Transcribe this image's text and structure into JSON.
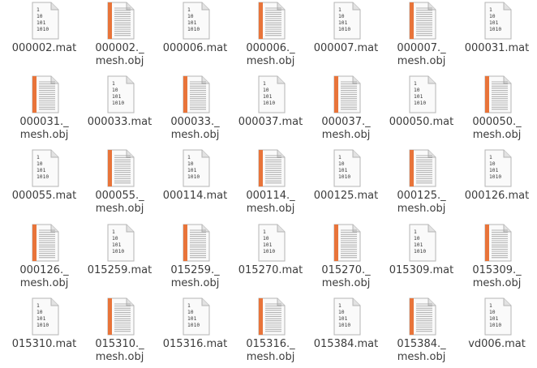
{
  "window": {
    "view": "icon-grid"
  },
  "binary_icon_lines": [
    "1",
    "10",
    "101",
    "1010"
  ],
  "files": [
    {
      "label": "000002.mat",
      "icon": "binary-file-icon"
    },
    {
      "label": "000002._\nmesh.obj",
      "icon": "text-document-icon"
    },
    {
      "label": "000006.mat",
      "icon": "binary-file-icon"
    },
    {
      "label": "000006._\nmesh.obj",
      "icon": "text-document-icon"
    },
    {
      "label": "000007.mat",
      "icon": "binary-file-icon"
    },
    {
      "label": "000007._\nmesh.obj",
      "icon": "text-document-icon"
    },
    {
      "label": "000031.mat",
      "icon": "binary-file-icon"
    },
    {
      "label": "000031._\nmesh.obj",
      "icon": "text-document-icon"
    },
    {
      "label": "000033.mat",
      "icon": "binary-file-icon"
    },
    {
      "label": "000033._\nmesh.obj",
      "icon": "text-document-icon"
    },
    {
      "label": "000037.mat",
      "icon": "binary-file-icon"
    },
    {
      "label": "000037._\nmesh.obj",
      "icon": "text-document-icon"
    },
    {
      "label": "000050.mat",
      "icon": "binary-file-icon"
    },
    {
      "label": "000050._\nmesh.obj",
      "icon": "text-document-icon"
    },
    {
      "label": "000055.mat",
      "icon": "binary-file-icon"
    },
    {
      "label": "000055._\nmesh.obj",
      "icon": "text-document-icon"
    },
    {
      "label": "000114.mat",
      "icon": "binary-file-icon"
    },
    {
      "label": "000114._\nmesh.obj",
      "icon": "text-document-icon"
    },
    {
      "label": "000125.mat",
      "icon": "binary-file-icon"
    },
    {
      "label": "000125._\nmesh.obj",
      "icon": "text-document-icon"
    },
    {
      "label": "000126.mat",
      "icon": "binary-file-icon"
    },
    {
      "label": "000126._\nmesh.obj",
      "icon": "text-document-icon"
    },
    {
      "label": "015259.mat",
      "icon": "binary-file-icon"
    },
    {
      "label": "015259._\nmesh.obj",
      "icon": "text-document-icon"
    },
    {
      "label": "015270.mat",
      "icon": "binary-file-icon"
    },
    {
      "label": "015270._\nmesh.obj",
      "icon": "text-document-icon"
    },
    {
      "label": "015309.mat",
      "icon": "binary-file-icon"
    },
    {
      "label": "015309._\nmesh.obj",
      "icon": "text-document-icon"
    },
    {
      "label": "015310.mat",
      "icon": "binary-file-icon"
    },
    {
      "label": "015310._\nmesh.obj",
      "icon": "text-document-icon"
    },
    {
      "label": "015316.mat",
      "icon": "binary-file-icon"
    },
    {
      "label": "015316._\nmesh.obj",
      "icon": "text-document-icon"
    },
    {
      "label": "015384.mat",
      "icon": "binary-file-icon"
    },
    {
      "label": "015384._\nmesh.obj",
      "icon": "text-document-icon"
    },
    {
      "label": "vd006.mat",
      "icon": "binary-file-icon"
    }
  ],
  "colors": {
    "page_bg": "#ffffff",
    "label_text": "#3c3c3c",
    "paper": "#fafafa",
    "paper_border": "#b4b4b4",
    "doc_spine": "#e8743a",
    "doc_lines": "#9a9a9a"
  }
}
